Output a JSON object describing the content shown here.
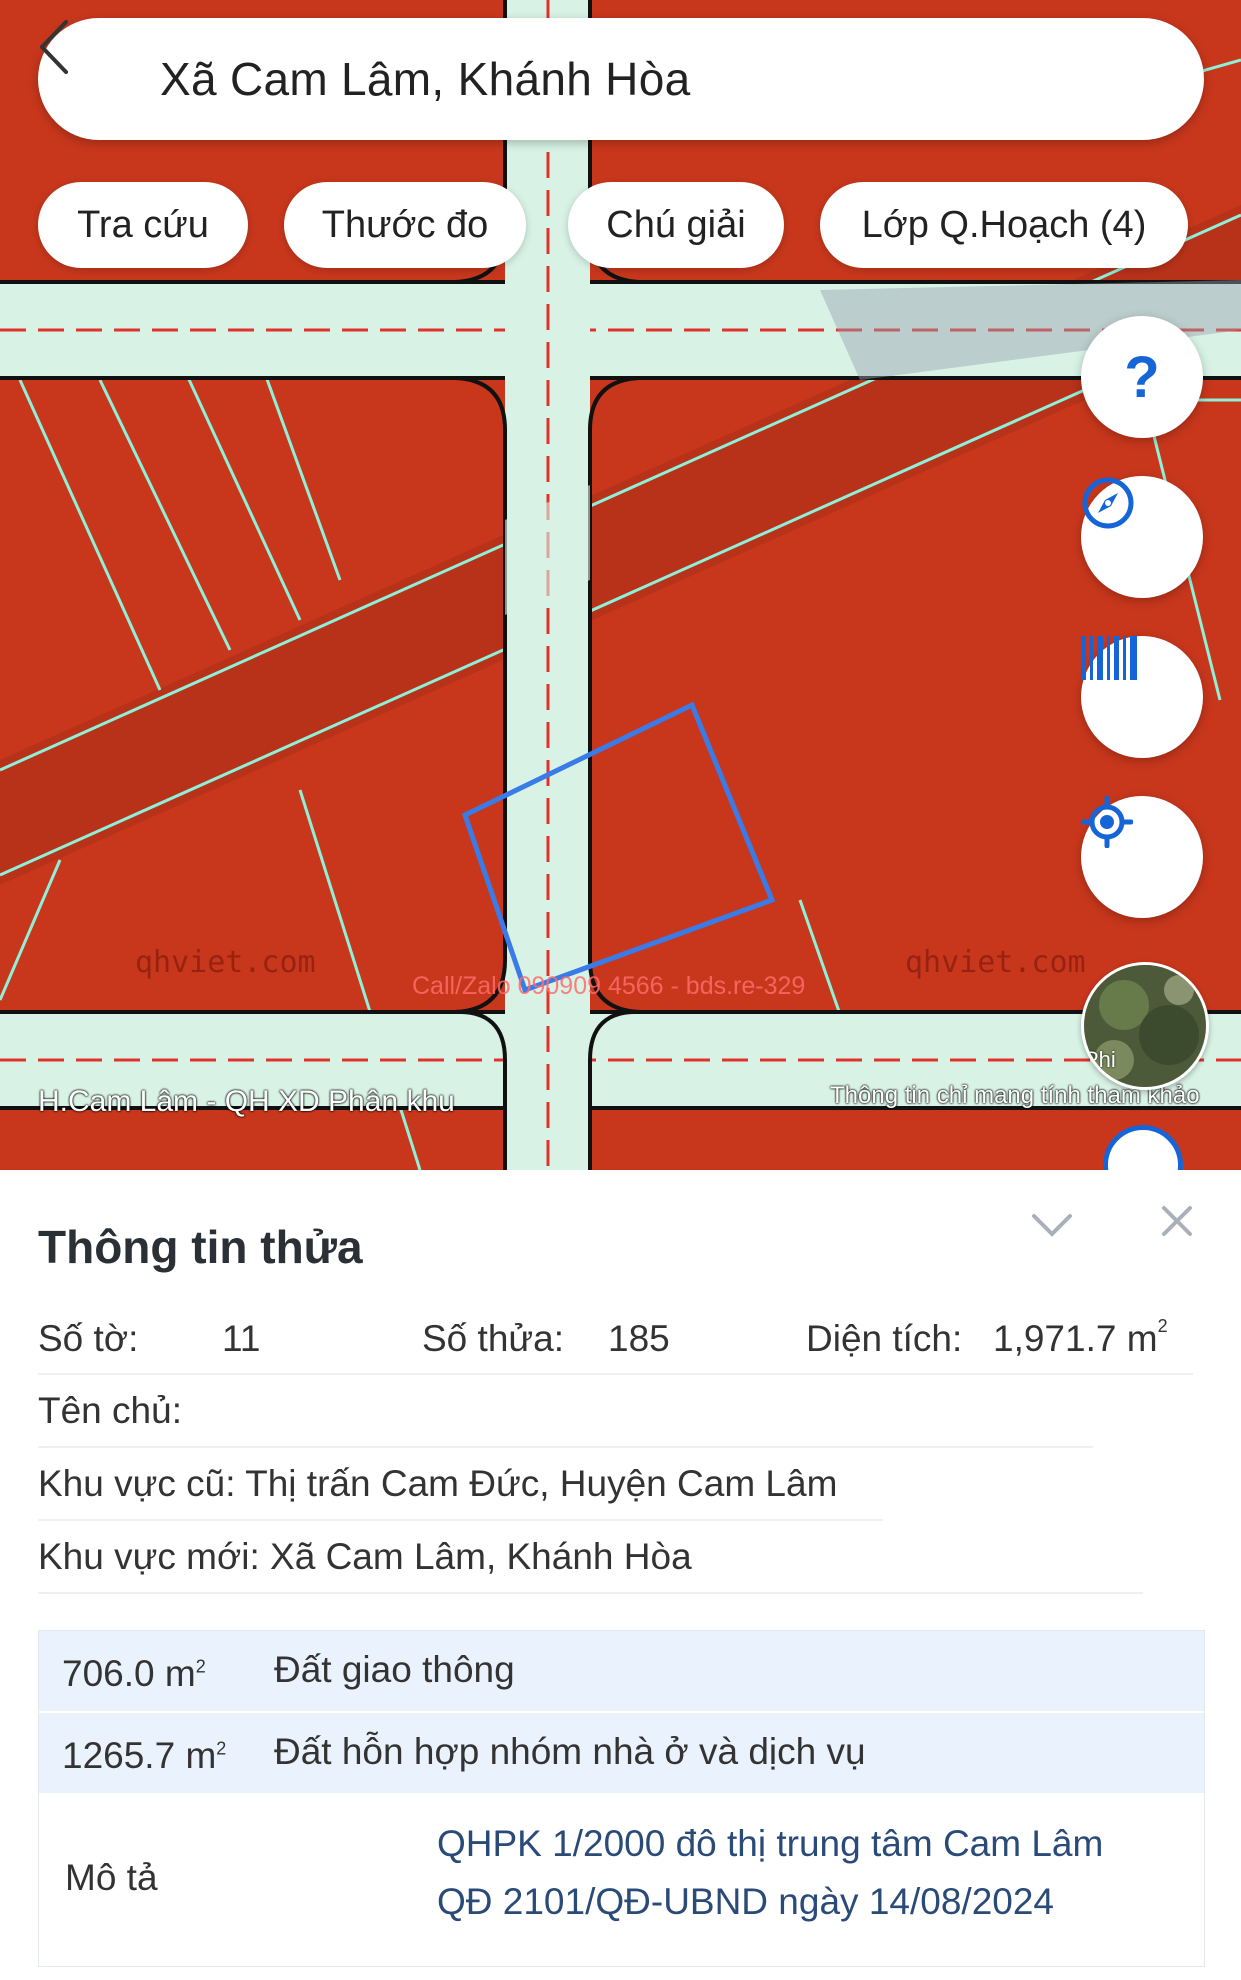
{
  "header": {
    "title": "Xã Cam Lâm, Khánh Hòa"
  },
  "chips": [
    "Tra cứu",
    "Thước đo",
    "Chú giải",
    "Lớp Q.Hoạch (4)"
  ],
  "fabs": {
    "help": "?"
  },
  "map": {
    "layer_label": "H.Cam Lâm - QH XD Phân khu",
    "disclaimer": "Thông tin chỉ mang tính tham khảo",
    "watermark": "qhviet.com",
    "call_text": "Call/Zalo 090909 4566 - bds.re-329",
    "satellite_label": "Phi"
  },
  "panel": {
    "title": "Thông tin thửa",
    "so_to_label": "Số tờ:",
    "so_to_value": "11",
    "so_thua_label": "Số thửa:",
    "so_thua_value": "185",
    "dien_tich_label": "Diện tích:",
    "dien_tich_value": "1,971.7 m",
    "ten_chu_label": "Tên chủ:",
    "khu_vuc_cu": "Khu vực cũ: Thị trấn Cam Đức, Huyện Cam Lâm",
    "khu_vuc_moi": "Khu vực mới: Xã Cam Lâm, Khánh Hòa"
  },
  "land_use": [
    {
      "area": "706.0 m",
      "type": "Đất giao thông"
    },
    {
      "area": "1265.7 m",
      "type": "Đất hỗn hợp nhóm nhà ở và dịch vụ"
    }
  ],
  "description": {
    "label": "Mô tả",
    "line1": "QHPK 1/2000 đô thị trung tâm Cam Lâm",
    "line2": "QĐ 2101/QĐ-UBND ngày 14/08/2024"
  },
  "colors": {
    "land": "#c8371c",
    "road": "#d8f3e6",
    "parcel": "#3b7be8",
    "accent": "#1565d8"
  }
}
